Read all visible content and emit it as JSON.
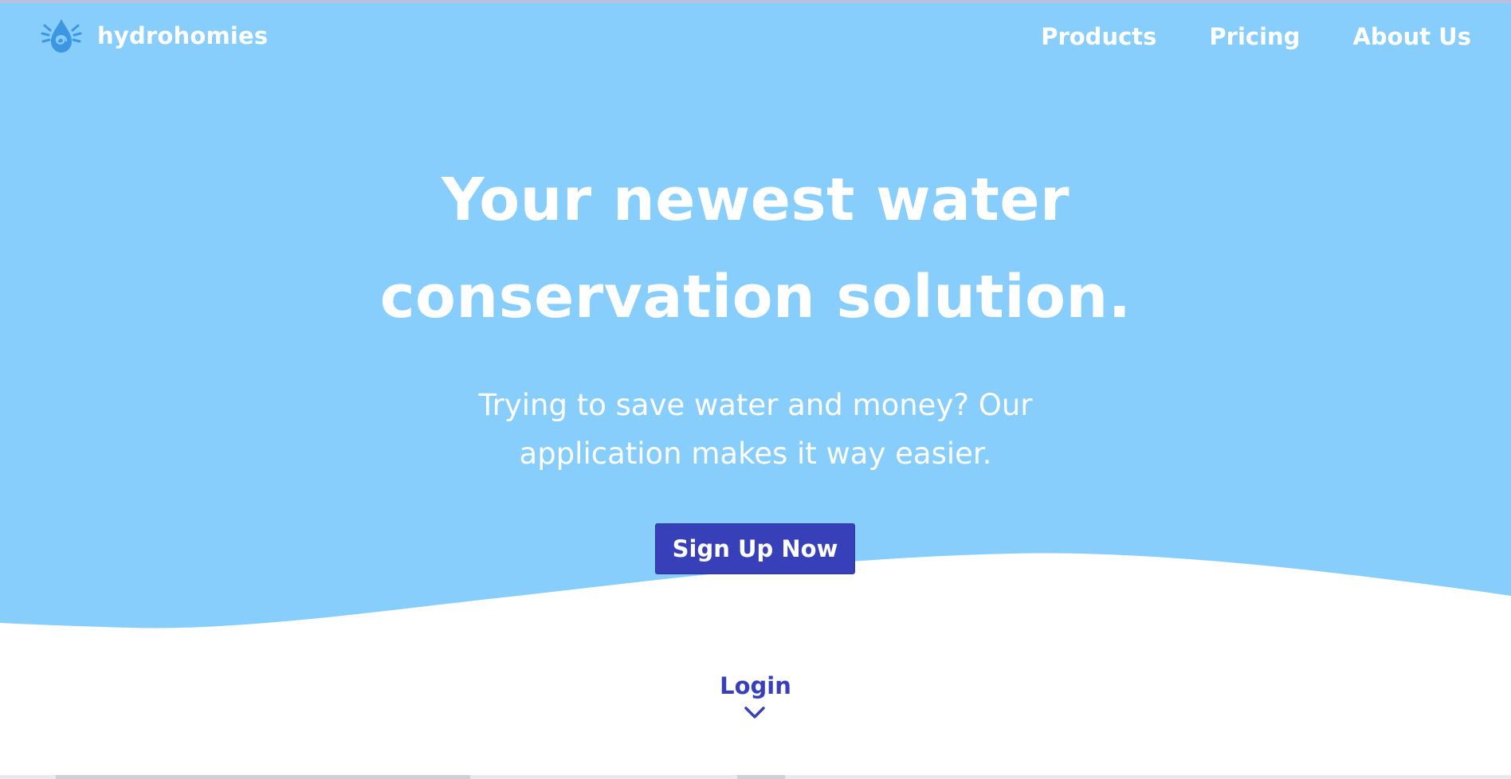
{
  "brand": {
    "name": "hydrohomies",
    "icon": "water-drop-logo-icon"
  },
  "nav": {
    "items": [
      {
        "label": "Products"
      },
      {
        "label": "Pricing"
      },
      {
        "label": "About Us"
      }
    ]
  },
  "hero": {
    "title_line1": "Your newest water",
    "title_line2": "conservation solution.",
    "subtitle_line1": "Trying to save water and money? Our",
    "subtitle_line2": "application makes it way easier.",
    "cta_label": "Sign Up Now"
  },
  "login": {
    "label": "Login",
    "icon": "chevron-down-icon"
  },
  "colors": {
    "hero_background": "#87cefd",
    "accent": "#3740b9",
    "logo": "#3d97e0",
    "text_light": "#ffffff"
  }
}
